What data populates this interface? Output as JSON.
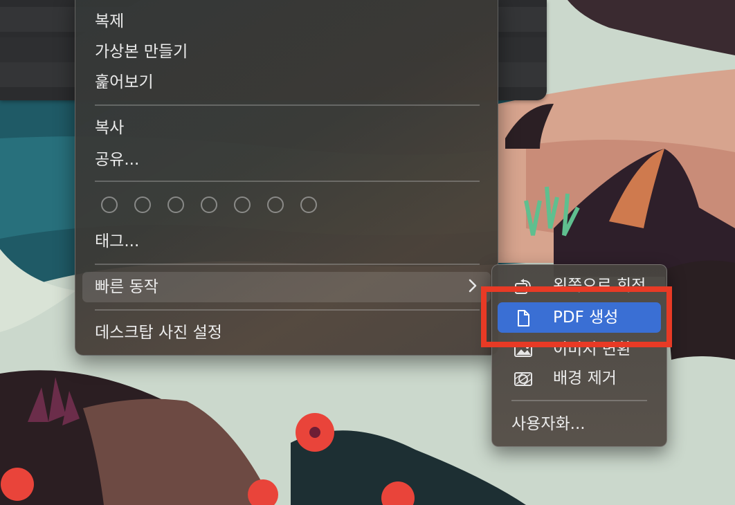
{
  "context_menu": {
    "items_group1": [
      "복제",
      "가상본 만들기",
      "훑어보기"
    ],
    "items_group2": [
      "복사",
      "공유..."
    ],
    "tags_label": "태그...",
    "quick_actions_label": "빠른 동작",
    "desktop_picture_label": "데스크탑 사진 설정",
    "tag_color_count": 7
  },
  "quick_actions_submenu": {
    "items": [
      {
        "label": "왼쪽으로 회전",
        "icon": "rotate-left-icon"
      },
      {
        "label": "PDF 생성",
        "icon": "document-icon",
        "selected": true
      },
      {
        "label": "이미지 변환",
        "icon": "image-icon"
      },
      {
        "label": "배경 제거",
        "icon": "remove-background-icon"
      }
    ],
    "customize_label": "사용자화..."
  },
  "colors": {
    "selection": "#3a6fd4",
    "annotation_box": "#e83a25"
  }
}
